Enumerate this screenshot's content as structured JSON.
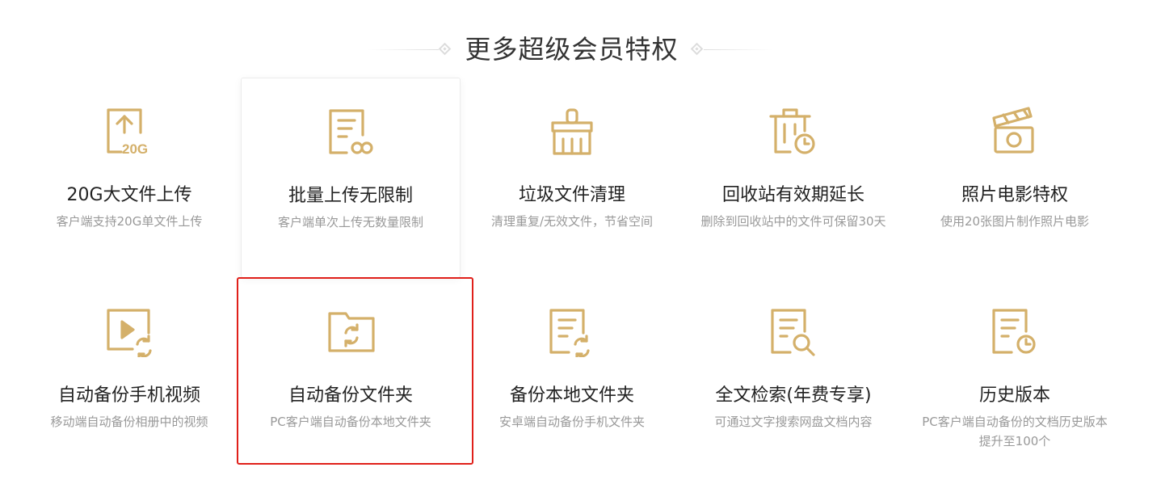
{
  "header": {
    "title": "更多超级会员特权"
  },
  "colors": {
    "icon_gold": "#d4b06a",
    "title_text": "#222222",
    "desc_text": "#999999",
    "highlight_border": "#e0201a"
  },
  "features": [
    {
      "icon": "upload-20g-icon",
      "title": "20G大文件上传",
      "desc": "客户端支持20G单文件上传"
    },
    {
      "icon": "unlimited-upload-icon",
      "title": "批量上传无限制",
      "desc": "客户端单次上传无数量限制"
    },
    {
      "icon": "broom-icon",
      "title": "垃圾文件清理",
      "desc": "清理重复/无效文件，节省空间"
    },
    {
      "icon": "trash-clock-icon",
      "title": "回收站有效期延长",
      "desc": "删除到回收站中的文件可保留30天"
    },
    {
      "icon": "clapperboard-icon",
      "title": "照片电影特权",
      "desc": "使用20张图片制作照片电影"
    },
    {
      "icon": "video-sync-icon",
      "title": "自动备份手机视频",
      "desc": "移动端自动备份相册中的视频"
    },
    {
      "icon": "folder-sync-icon",
      "title": "自动备份文件夹",
      "desc": "PC客户端自动备份本地文件夹"
    },
    {
      "icon": "document-sync-icon",
      "title": "备份本地文件夹",
      "desc": "安卓端自动备份手机文件夹"
    },
    {
      "icon": "document-search-icon",
      "title": "全文检索(年费专享)",
      "desc": "可通过文字搜索网盘文档内容"
    },
    {
      "icon": "document-history-icon",
      "title": "历史版本",
      "desc": "PC客户端自动备份的文档历史版本提升至100个"
    }
  ]
}
